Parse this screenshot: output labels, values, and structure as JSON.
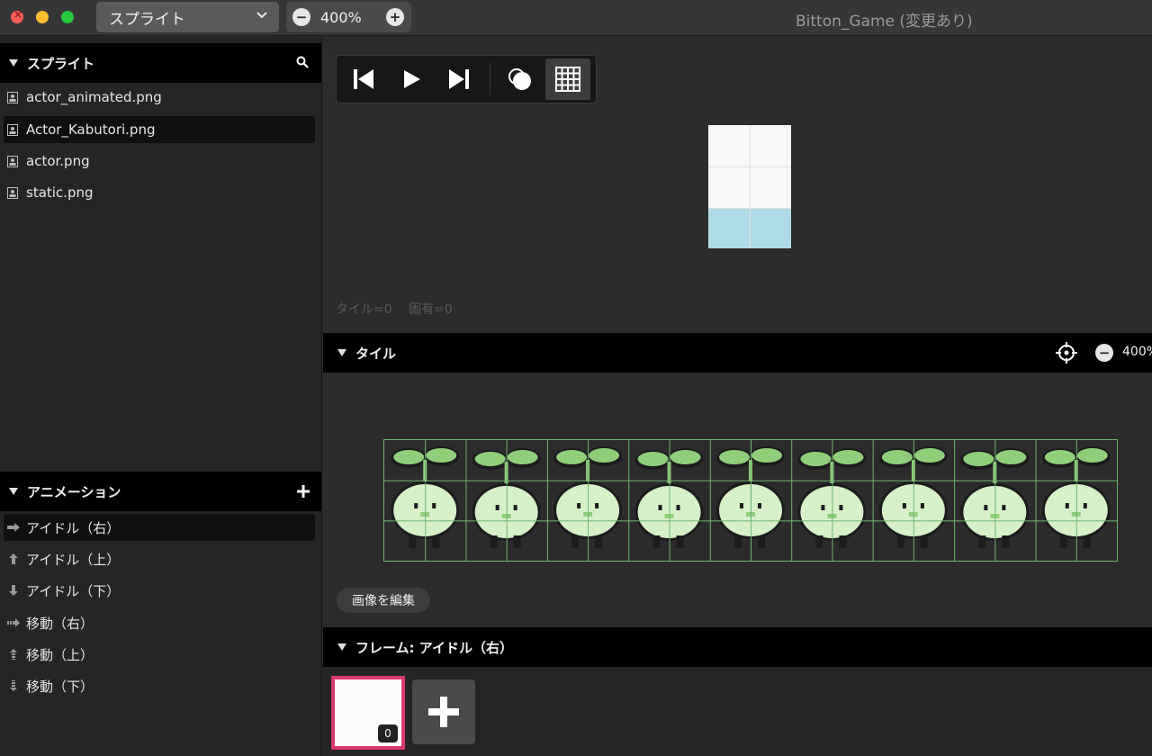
{
  "window": {
    "title": "Bitton_Game (変更あり)",
    "mode_selected": "スプライト",
    "zoom": "400%"
  },
  "sidebar": {
    "sprites_header": "スプライト",
    "sprites": [
      {
        "label": "actor_animated.png"
      },
      {
        "label": "Actor_Kabutori.png",
        "selected": true
      },
      {
        "label": "actor.png"
      },
      {
        "label": "static.png"
      }
    ],
    "animations_header": "アニメーション",
    "animations": [
      {
        "label": "アイドル（右）",
        "icon": "arrow-right-icon",
        "selected": true
      },
      {
        "label": "アイドル（上）",
        "icon": "arrow-up-icon"
      },
      {
        "label": "アイドル（下）",
        "icon": "arrow-down-icon"
      },
      {
        "label": "移動（右）",
        "icon": "move-right-icon"
      },
      {
        "label": "移動（上）",
        "icon": "move-up-icon"
      },
      {
        "label": "移動（下）",
        "icon": "move-down-icon"
      }
    ]
  },
  "preview": {
    "status_tile": "タイル=0",
    "status_prop": "固有=0"
  },
  "tiles": {
    "header": "タイル",
    "zoom": "400%",
    "edit_button": "画像を編集",
    "frame_count": 9
  },
  "frames": {
    "header": "フレーム: アイドル（右）",
    "items": [
      {
        "number": "0"
      }
    ]
  },
  "colors": {
    "frame_selected": "#d83a6c",
    "grid": "#6fb56f",
    "sprite_light": "#d6f0c8",
    "sprite_mid": "#8fcf7a",
    "sprite_dark": "#1c1c1c"
  }
}
